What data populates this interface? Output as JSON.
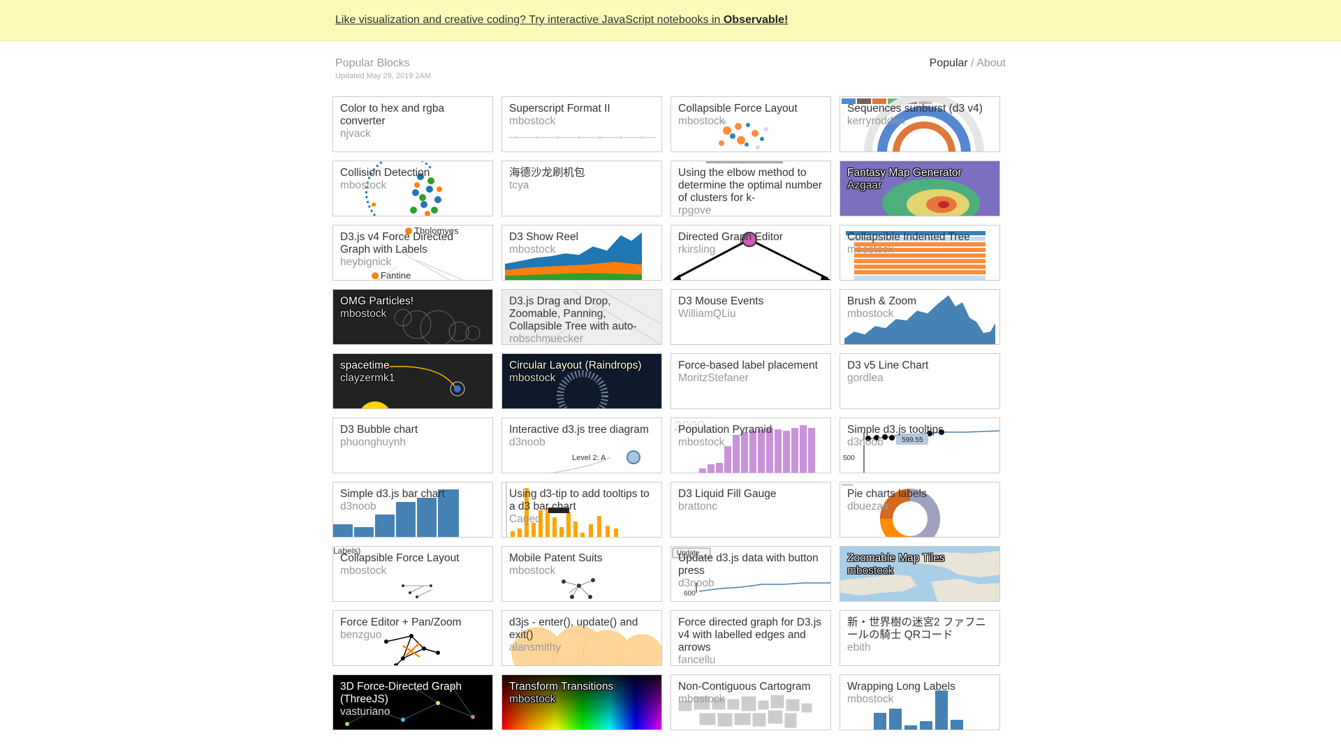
{
  "banner": {
    "text": "Like visualization and creative coding? Try interactive JavaScript notebooks in ",
    "link": "Observable!"
  },
  "header": {
    "title": "Popular Blocks",
    "updated": "Updated May 29, 2019 2AM",
    "nav_popular": "Popular",
    "nav_sep": " / ",
    "nav_about": "About"
  },
  "blocks": [
    {
      "title": "Color to hex and rgba converter",
      "author": "njvack"
    },
    {
      "title": "Superscript Format II",
      "author": "mbostock"
    },
    {
      "title": "Collapsible Force Layout",
      "author": "mbostock"
    },
    {
      "title": "Sequences sunburst (d3 v4)",
      "author": "kerryrodden"
    },
    {
      "title": "Collision Detection",
      "author": "mbostock"
    },
    {
      "title": "海德沙龙刷机包",
      "author": "tcya"
    },
    {
      "title": "Using the elbow method to determine the optimal number of clusters for k-",
      "author": "rpgove"
    },
    {
      "title": "Fantasy Map Generator",
      "author": "Azgaar"
    },
    {
      "title": "D3.js v4 Force Directed Graph with Labels",
      "author": "heybignick"
    },
    {
      "title": "D3 Show Reel",
      "author": "mbostock"
    },
    {
      "title": "Directed Graph Editor",
      "author": "rkirsling"
    },
    {
      "title": "Collapsible Indented Tree",
      "author": "mbostock"
    },
    {
      "title": "OMG Particles!",
      "author": "mbostock"
    },
    {
      "title": "D3.js Drag and Drop, Zoomable, Panning, Collapsible Tree with auto-",
      "author": "robschmuecker"
    },
    {
      "title": "D3 Mouse Events",
      "author": "WilliamQLiu"
    },
    {
      "title": "Brush & Zoom",
      "author": "mbostock"
    },
    {
      "title": "spacetime",
      "author": "clayzermk1"
    },
    {
      "title": "Circular Layout (Raindrops)",
      "author": "mbostock"
    },
    {
      "title": "Force-based label placement",
      "author": "MoritzStefaner"
    },
    {
      "title": "D3 v5 Line Chart",
      "author": "gordlea"
    },
    {
      "title": "D3 Bubble chart",
      "author": "phuonghuynh"
    },
    {
      "title": "Interactive d3.js tree diagram",
      "author": "d3noob"
    },
    {
      "title": "Population Pyramid",
      "author": "mbostock"
    },
    {
      "title": "Simple d3.js tooltips",
      "author": "d3noob"
    },
    {
      "title": "Simple d3.js bar chart",
      "author": "d3noob"
    },
    {
      "title": "Using d3-tip to add tooltips to a d3 bar chart",
      "author": "Caged"
    },
    {
      "title": "D3 Liquid Fill Gauge",
      "author": "brattonc"
    },
    {
      "title": "Pie charts labels",
      "author": "dbuezas"
    },
    {
      "title": "Collapsible Force Layout",
      "author": "mbostock"
    },
    {
      "title": "Mobile Patent Suits",
      "author": "mbostock"
    },
    {
      "title": "Update d3.js data with button press",
      "author": "d3noob"
    },
    {
      "title": "Zoomable Map Tiles",
      "author": "mbostock"
    },
    {
      "title": "Force Editor + Pan/Zoom",
      "author": "benzguo"
    },
    {
      "title": "d3js - enter(), update() and exit()",
      "author": "alansmithy"
    },
    {
      "title": "Force directed graph for D3.js v4 with labelled edges and arrows",
      "author": "fancellu"
    },
    {
      "title": "新・世界樹の迷宮2 ファフニールの騎士 QRコード",
      "author": "ebith"
    },
    {
      "title": "3D Force-Directed Graph (ThreeJS)",
      "author": "vasturiano"
    },
    {
      "title": "Transform Transitions",
      "author": "mbostock"
    },
    {
      "title": "Non-Contiguous Cartogram",
      "author": "mbostock"
    },
    {
      "title": "Wrapping Long Labels",
      "author": "mbostock"
    }
  ],
  "thumb_text": {
    "tholomyes": "Tholomyes",
    "fantine": "Fantine",
    "level2": "Level 2: A",
    "year": "2000",
    "tip_value": "599.55",
    "axis_500": "500",
    "axis_600": "600",
    "labels": "Labels)",
    "update": "Update"
  },
  "colors": {
    "banner_bg": "#fdfab9",
    "steelblue": "#4682b4",
    "orange": "#ff7f0e",
    "green": "#2ca02c",
    "purple": "#c27fd6"
  }
}
